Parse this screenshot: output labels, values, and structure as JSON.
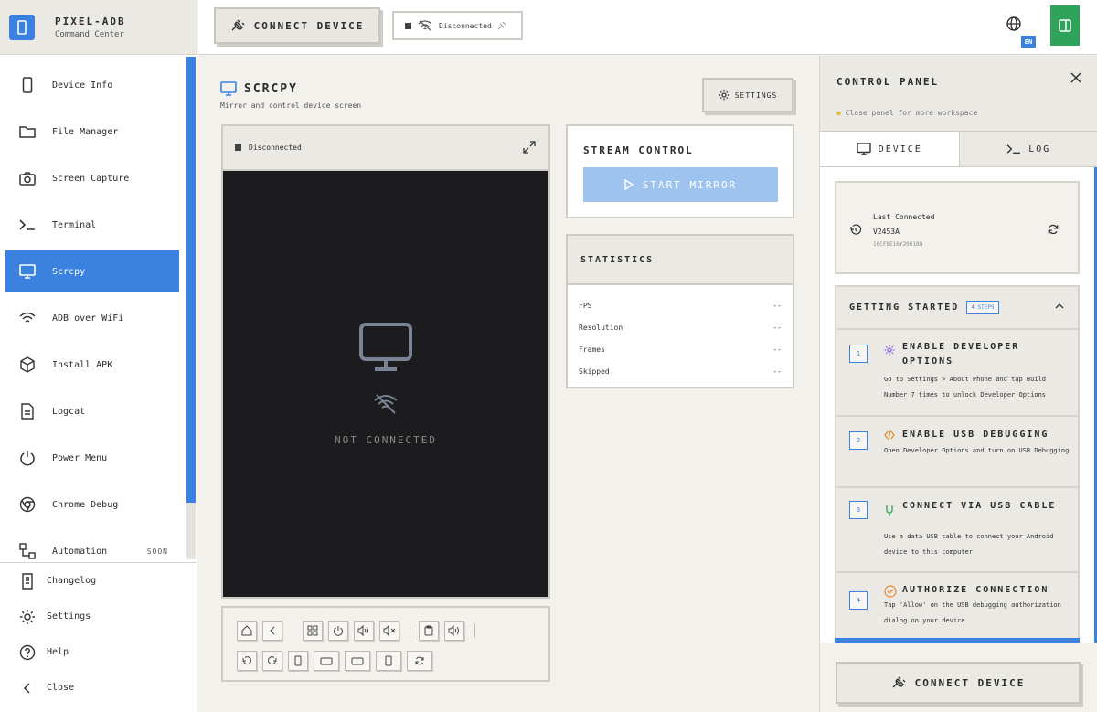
{
  "brand": {
    "title": "PIXEL-ADB",
    "subtitle": "Command Center"
  },
  "topbar": {
    "connect_label": "CONNECT DEVICE",
    "status_label": "Disconnected",
    "lang_badge": "EN"
  },
  "nav": {
    "items": [
      {
        "label": "Device Info",
        "icon": "phone-icon"
      },
      {
        "label": "File Manager",
        "icon": "folder-icon"
      },
      {
        "label": "Screen Capture",
        "icon": "camera-icon"
      },
      {
        "label": "Terminal",
        "icon": "terminal-icon"
      },
      {
        "label": "Scrcpy",
        "icon": "monitor-icon",
        "active": true
      },
      {
        "label": "ADB over WiFi",
        "icon": "wifi-icon"
      },
      {
        "label": "Install APK",
        "icon": "package-icon"
      },
      {
        "label": "Logcat",
        "icon": "file-text-icon"
      },
      {
        "label": "Power Menu",
        "icon": "power-icon"
      },
      {
        "label": "Chrome Debug",
        "icon": "chrome-icon"
      },
      {
        "label": "Automation",
        "icon": "workflow-icon",
        "badge": "SOON"
      }
    ],
    "bottom": [
      {
        "label": "Changelog",
        "icon": "scroll-icon"
      },
      {
        "label": "Settings",
        "icon": "gear-icon"
      },
      {
        "label": "Help",
        "icon": "help-icon"
      },
      {
        "label": "Close",
        "icon": "chevron-left-icon"
      }
    ]
  },
  "main": {
    "title": "SCRCPY",
    "subtitle": "Mirror and control device screen",
    "settings_label": "SETTINGS",
    "screen": {
      "status": "Disconnected",
      "not_connected": "NOT CONNECTED"
    },
    "stream": {
      "title": "STREAM CONTROL",
      "start_label": "START MIRROR"
    },
    "stats": {
      "title": "STATISTICS",
      "rows": [
        {
          "label": "FPS",
          "value": "--"
        },
        {
          "label": "Resolution",
          "value": "--"
        },
        {
          "label": "Frames",
          "value": "--"
        },
        {
          "label": "Skipped",
          "value": "--"
        }
      ]
    }
  },
  "panel": {
    "title": "CONTROL PANEL",
    "hint": "Close panel for more workspace",
    "tabs": {
      "device": "DEVICE",
      "log": "LOG"
    },
    "last": {
      "label": "Last Connected",
      "name": "V2453A",
      "serial": "10CF8E16Y20018Q"
    },
    "getting_started": {
      "title": "GETTING STARTED",
      "badge": "4 steps",
      "steps": [
        {
          "num": "1",
          "title": "ENABLE DEVELOPER OPTIONS",
          "desc": "Go to Settings > About Phone and tap Build Number 7 times to unlock Developer Options"
        },
        {
          "num": "2",
          "title": "ENABLE USB DEBUGGING",
          "desc": "Open Developer Options and turn on USB Debugging"
        },
        {
          "num": "3",
          "title": "CONNECT VIA USB CABLE",
          "desc": "Use a data USB cable to connect your Android device to this computer"
        },
        {
          "num": "4",
          "title": "AUTHORIZE CONNECTION",
          "desc": "Tap 'Allow' on the USB debugging authorization dialog on your device"
        }
      ]
    },
    "connect_label": "CONNECT DEVICE"
  },
  "colors": {
    "accent": "#3b82e0",
    "success": "#2fa35a",
    "screen": "#1c1c1e",
    "start_disabled": "#9fc3ef"
  }
}
